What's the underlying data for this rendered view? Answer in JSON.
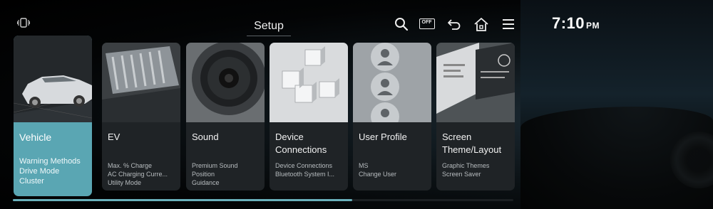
{
  "header": {
    "title": "Setup",
    "time": "7:10",
    "ampm": "PM",
    "icons": [
      "vibration-icon",
      "search-icon",
      "screen-off-icon",
      "back-icon",
      "home-icon",
      "menu-icon"
    ],
    "off_label": "OFF"
  },
  "cards": [
    {
      "title": "Vehicle",
      "items": [
        "Warning Methods",
        "Drive Mode",
        "Cluster"
      ],
      "selected": true
    },
    {
      "title": "EV",
      "items": [
        "Max. % Charge",
        "AC Charging Curre...",
        "Utility Mode"
      ]
    },
    {
      "title": "Sound",
      "items": [
        "Premium Sound",
        "Position",
        "Guidance"
      ]
    },
    {
      "title": "Device Connections",
      "title_line1": "Device",
      "title_line2": "Connections",
      "items": [
        "Device Connections",
        "Bluetooth System I..."
      ]
    },
    {
      "title": "User Profile",
      "items": [
        "MS",
        "Change User"
      ]
    },
    {
      "title": "Screen Theme/Layout",
      "title_line1": "Screen",
      "title_line2": "Theme/Layout",
      "items": [
        "Graphic Themes",
        "Screen Saver"
      ]
    }
  ],
  "colors": {
    "accent": "#5aa6b3",
    "card": "#1f2326",
    "background": "#000000"
  }
}
